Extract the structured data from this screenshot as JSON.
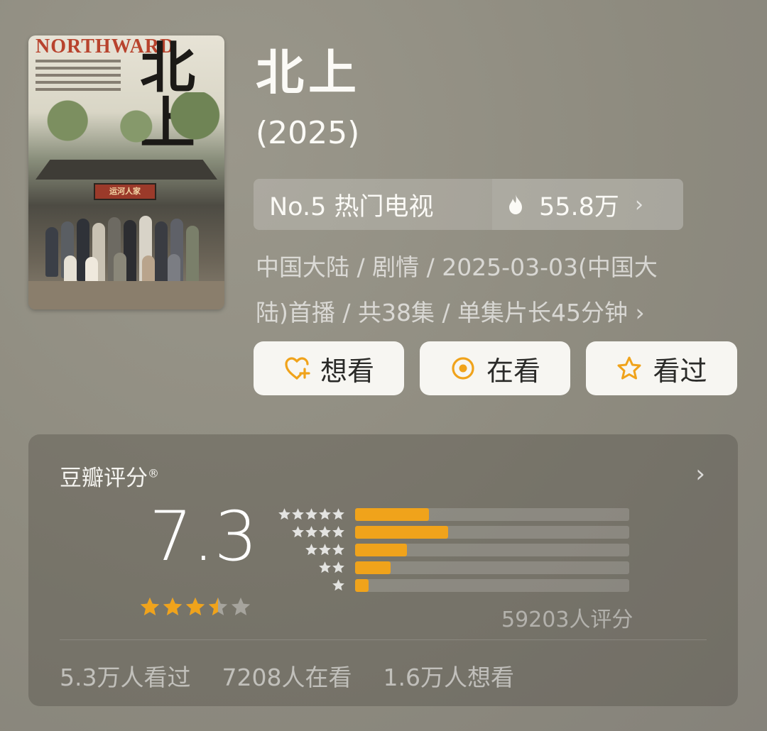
{
  "poster": {
    "title_en": "NORTHWARD",
    "title_zh": "北上",
    "sign_text": "运河人家"
  },
  "title": "北上",
  "year": "(2025)",
  "ranking": {
    "label": "No.5 热门电视",
    "heat": "55.8万"
  },
  "meta": {
    "line1": "中国大陆 / 剧情 / 2025-03-03(中国大",
    "line2": "陆)首播 / 共38集 / 单集片长45分钟 ›"
  },
  "actions": [
    {
      "label": "想看",
      "icon": "heart-plus-icon"
    },
    {
      "label": "在看",
      "icon": "target-circle-icon"
    },
    {
      "label": "看过",
      "icon": "star-outline-icon"
    }
  ],
  "rating": {
    "title": "豆瓣评分",
    "registered_mark": "®",
    "score": "7.3",
    "stars_value": 3.5,
    "distribution": [
      {
        "stars": 5,
        "fraction": 0.27
      },
      {
        "stars": 4,
        "fraction": 0.34
      },
      {
        "stars": 3,
        "fraction": 0.19
      },
      {
        "stars": 2,
        "fraction": 0.13
      },
      {
        "stars": 1,
        "fraction": 0.05
      }
    ],
    "count": "59203人评分"
  },
  "stats": {
    "watched": "5.3万人看过",
    "watching": "7208人在看",
    "wish": "1.6万人想看"
  },
  "colors": {
    "accent": "#f0a31b",
    "background": "#8f8c80"
  }
}
